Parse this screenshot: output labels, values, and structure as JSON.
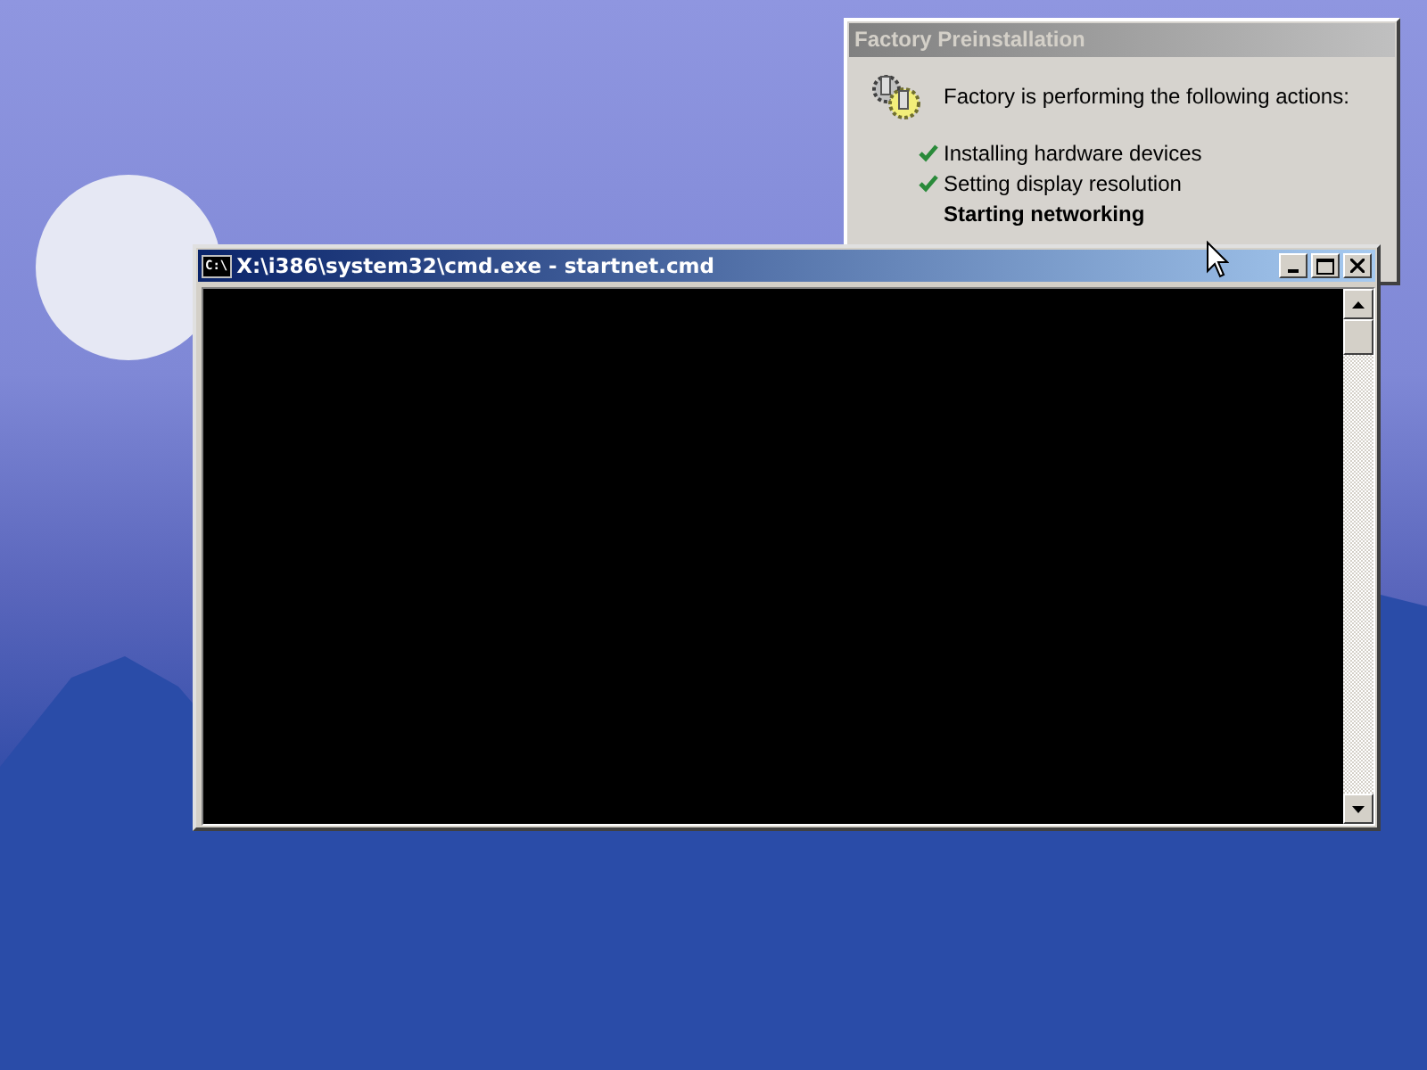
{
  "setup_dialog": {
    "title": "Factory Preinstallation",
    "intro": "Factory is performing the following actions:",
    "actions": [
      {
        "label": "Installing hardware devices",
        "done": true
      },
      {
        "label": "Setting display resolution",
        "done": true
      },
      {
        "label": "Starting networking",
        "done": false
      }
    ]
  },
  "console_window": {
    "title": "X:\\i386\\system32\\cmd.exe - startnet.cmd",
    "icon_text": "C:\\",
    "active": true
  }
}
